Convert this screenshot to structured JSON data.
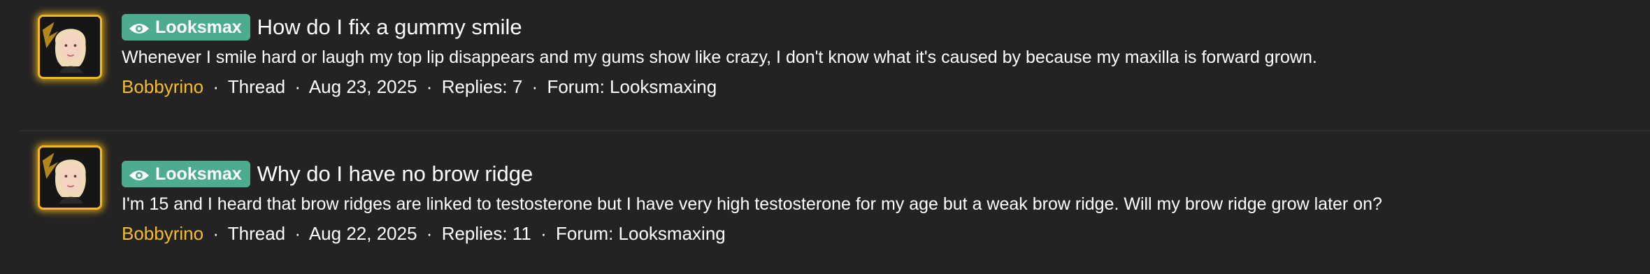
{
  "colors": {
    "background": "#232323",
    "prefix_bg": "#4dab8f",
    "author": "#f5bd2a",
    "avatar_border": "#f5b821"
  },
  "results": [
    {
      "prefix_icon": "eye-icon",
      "prefix": "Looksmax",
      "title": "How do I fix a gummy smile",
      "snippet": "Whenever I smile hard or laugh my top lip disappears and my gums show like crazy, I don't know what it's caused by because my maxilla is forward grown.",
      "author": "Bobbyrino",
      "type": "Thread",
      "date": "Aug 23, 2025",
      "replies": "Replies: 7",
      "forum": "Forum: Looksmaxing",
      "sep": "·"
    },
    {
      "prefix_icon": "eye-icon",
      "prefix": "Looksmax",
      "title": "Why do I have no brow ridge",
      "snippet": "I'm 15 and I heard that brow ridges are linked to testosterone but I have very high testosterone for my age but a weak brow ridge. Will my brow ridge grow later on?",
      "author": "Bobbyrino",
      "type": "Thread",
      "date": "Aug 22, 2025",
      "replies": "Replies: 11",
      "forum": "Forum: Looksmaxing",
      "sep": "·"
    }
  ]
}
